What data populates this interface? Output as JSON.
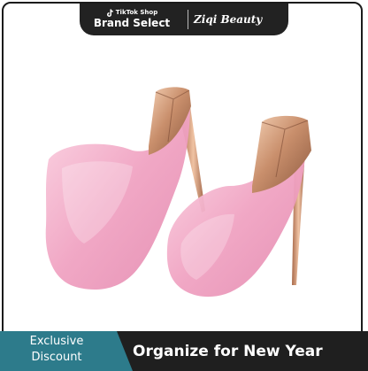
{
  "header": {
    "platform_label": "TikTok Shop",
    "badge_label": "Brand Select",
    "brand_name": "Ziqi Beauty"
  },
  "product": {
    "image_description_icon": "high-heel-perfume-bottles"
  },
  "footer": {
    "discount_line1": "Exclusive",
    "discount_line2": "Discount",
    "promo_text": "Organize for New Year"
  },
  "colors": {
    "banner_dark": "#222222",
    "discount_teal": "#2d7b8b",
    "bottle_pink": "#f2a7c4",
    "cap_rose_gold": "#c58f6e"
  }
}
